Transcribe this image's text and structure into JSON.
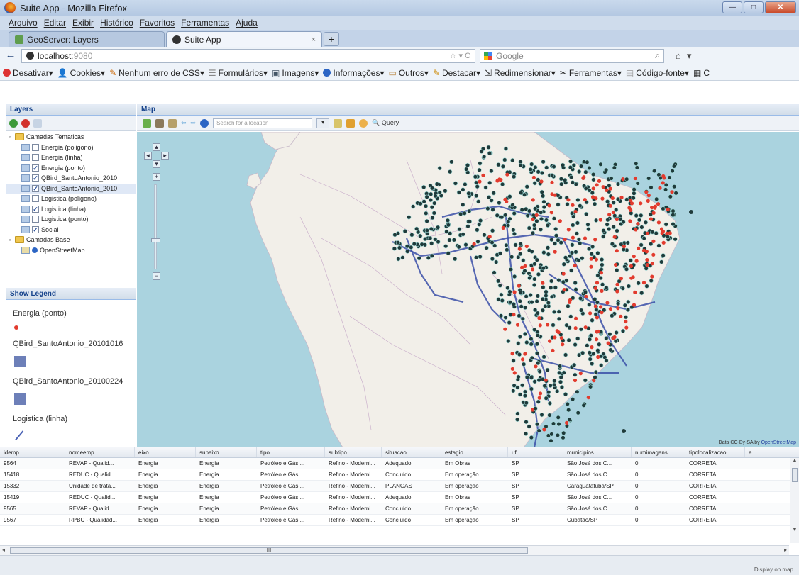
{
  "window": {
    "title": "Suite App - Mozilla Firefox",
    "min": "—",
    "max": "□",
    "close": "✕"
  },
  "menu": [
    "Arquivo",
    "Editar",
    "Exibir",
    "Histórico",
    "Favoritos",
    "Ferramentas",
    "Ajuda"
  ],
  "tabs": [
    {
      "label": "GeoServer: Layers",
      "close": ""
    },
    {
      "label": "Suite App",
      "close": "×"
    }
  ],
  "newtab": "+",
  "nav": {
    "back": "←",
    "url_host": "localhost",
    "url_port": ":9080",
    "url_star": "☆ ▾ C",
    "search_placeholder": "Google",
    "search_icon": "⌕",
    "home": "⌂",
    "extra": "▾"
  },
  "devbar": [
    "Desativar▾",
    "Cookies▾",
    "Nenhum erro de CSS▾",
    "Formulários▾",
    "Imagens▾",
    "Informações▾",
    "Outros▾",
    "Destacar▾",
    "Redimensionar▾",
    "Ferramentas▾",
    "Código-fonte▾",
    "C"
  ],
  "layers": {
    "title": "Layers",
    "tree": [
      {
        "label": "Camadas Tematicas",
        "type": "folder",
        "checked": null
      },
      {
        "label": "Energia (poligono)",
        "type": "layer",
        "checked": false
      },
      {
        "label": "Energia (linha)",
        "type": "layer",
        "checked": false
      },
      {
        "label": "Energia (ponto)",
        "type": "layer",
        "checked": true
      },
      {
        "label": "QBird_SantoAntonio_2010",
        "type": "layer",
        "checked": true
      },
      {
        "label": "QBird_SantoAntonio_2010",
        "type": "layer",
        "checked": true,
        "selected": true
      },
      {
        "label": "Logistica (poligono)",
        "type": "layer",
        "checked": false
      },
      {
        "label": "Logistica (linha)",
        "type": "layer",
        "checked": true
      },
      {
        "label": "Logistica (ponto)",
        "type": "layer",
        "checked": false
      },
      {
        "label": "Social",
        "type": "layer",
        "checked": true
      },
      {
        "label": "Camadas Base",
        "type": "folder",
        "checked": null
      },
      {
        "label": "OpenStreetMap",
        "type": "base",
        "checked": null
      }
    ]
  },
  "legend": {
    "title": "Show Legend",
    "items": [
      {
        "label": "Energia (ponto)",
        "symbol": "point"
      },
      {
        "label": "QBird_SantoAntonio_20101016",
        "symbol": "square"
      },
      {
        "label": "QBird_SantoAntonio_20100224",
        "symbol": "square"
      },
      {
        "label": "Logistica (linha)",
        "symbol": "line"
      }
    ]
  },
  "map": {
    "title": "Map",
    "search_placeholder": "Search for a location",
    "query_label": "Query",
    "attribution": "Data CC-By-SA by",
    "attribution_link": "OpenStreetMap"
  },
  "grid": {
    "columns": [
      "idemp",
      "nomeemp",
      "eixo",
      "subeixo",
      "tipo",
      "subtipo",
      "situacao",
      "estagio",
      "uf",
      "municipios",
      "numimagens",
      "tipolocalizacao",
      "e"
    ],
    "rows": [
      [
        "9564",
        "REVAP - Qualid...",
        "Energia",
        "Energia",
        "Petróleo e Gás ...",
        "Refino - Moderni...",
        "Adequado",
        "Em Obras",
        "SP",
        "São José dos C...",
        "0",
        "CORRETA",
        ""
      ],
      [
        "15418",
        "REDUC - Qualid...",
        "Energia",
        "Energia",
        "Petróleo e Gás ...",
        "Refino - Moderni...",
        "Concluído",
        "Em operação",
        "SP",
        "São José dos C...",
        "0",
        "CORRETA",
        ""
      ],
      [
        "15332",
        "Unidade de trata...",
        "Energia",
        "Energia",
        "Petróleo e Gás ...",
        "Refino - Moderni...",
        "PLANGAS",
        "Em operação",
        "SP",
        "Caraguatatuba/SP",
        "0",
        "CORRETA",
        ""
      ],
      [
        "15419",
        "REDUC - Qualid...",
        "Energia",
        "Energia",
        "Petróleo e Gás ...",
        "Refino - Moderni...",
        "Adequado",
        "Em Obras",
        "SP",
        "São José dos C...",
        "0",
        "CORRETA",
        ""
      ],
      [
        "9565",
        "REVAP - Qualid...",
        "Energia",
        "Energia",
        "Petróleo e Gás ...",
        "Refino - Moderni...",
        "Concluído",
        "Em operação",
        "SP",
        "São José dos C...",
        "0",
        "CORRETA",
        ""
      ],
      [
        "9567",
        "RPBC - Qualidad...",
        "Energia",
        "Energia",
        "Petróleo e Gás ...",
        "Refino - Moderni...",
        "Concluído",
        "Em operação",
        "SP",
        "Cubatão/SP",
        "0",
        "CORRETA",
        ""
      ]
    ],
    "hscroll_label": "III"
  },
  "status": {
    "display_on_map": "Display on map"
  },
  "colors": {
    "accent": "#15428b",
    "point_red": "#e23b2e",
    "point_teal": "#1f3a3a",
    "line_blue": "#3b4fa8",
    "sea": "#aad3df",
    "land": "#f2efe9"
  }
}
